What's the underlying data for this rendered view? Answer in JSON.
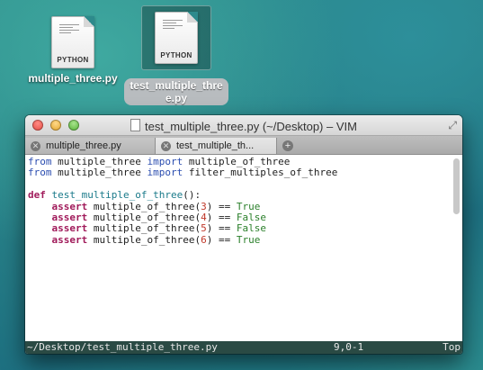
{
  "desktop": {
    "icons": [
      {
        "type": "PYTHON",
        "label": "multiple_three.py",
        "selected": false
      },
      {
        "type": "PYTHON",
        "label": "test_multiple_three.py",
        "selected": true
      }
    ]
  },
  "window": {
    "title": "test_multiple_three.py (~/Desktop) – VIM",
    "tabs": [
      {
        "label": "multiple_three.py",
        "active": false
      },
      {
        "label": "test_multiple_th...",
        "active": true
      }
    ],
    "add_tab": "+"
  },
  "code": {
    "line1": {
      "from": "from",
      "module": " multiple_three ",
      "import": "import",
      "name": " multiple_of_three"
    },
    "line2": {
      "from": "from",
      "module": " multiple_three ",
      "import": "import",
      "name": " filter_multiples_of_three"
    },
    "line4": {
      "def": "def",
      "name": " test_multiple_of_three",
      "rest": "():"
    },
    "asserts": [
      {
        "kw": "assert",
        "call": " multiple_of_three(",
        "arg": "3",
        "close": ") == ",
        "result": "True"
      },
      {
        "kw": "assert",
        "call": " multiple_of_three(",
        "arg": "4",
        "close": ") == ",
        "result": "False"
      },
      {
        "kw": "assert",
        "call": " multiple_of_three(",
        "arg": "5",
        "close": ") == ",
        "result": "False"
      },
      {
        "kw": "assert",
        "call": " multiple_of_three(",
        "arg": "6",
        "close": ") == ",
        "result": "True"
      }
    ]
  },
  "statusline": {
    "path": "~/Desktop/test_multiple_three.py",
    "position": "9,0-1",
    "scroll": "Top"
  }
}
